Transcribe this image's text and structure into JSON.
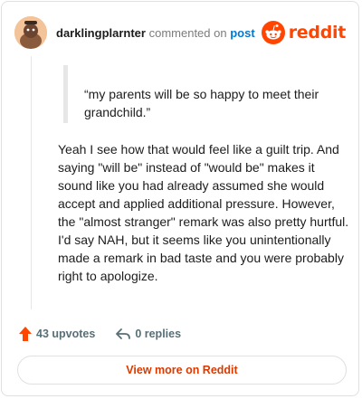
{
  "comment": {
    "author": "darklingplarnter",
    "verb": "commented on",
    "post_link": "post",
    "quote": "“my parents will be so happy to meet their grandchild.”",
    "body": "Yeah I see how that would feel like a guilt trip. And saying \"will be\" instead of \"would be\" makes it sound like you had already assumed she would accept and applied additional pressure. However, the \"almost stranger\" remark was also pretty hurtful. I'd say NAH, but it seems like you unintentionally made a remark in bad taste and you were probably right to apologize."
  },
  "brand": {
    "wordmark": "reddit",
    "color": "#ff4500"
  },
  "actions": {
    "upvotes": "43 upvotes",
    "replies": "0 replies"
  },
  "footer": {
    "view_more": "View more on Reddit"
  },
  "icons": {
    "avatar": "avatar",
    "brand": "reddit-logo-icon",
    "upvote": "upvote-arrow-icon",
    "reply": "reply-arrow-icon"
  },
  "colors": {
    "upvote": "#ff4500",
    "link": "#0079d3",
    "view_more": "#d93a00"
  }
}
